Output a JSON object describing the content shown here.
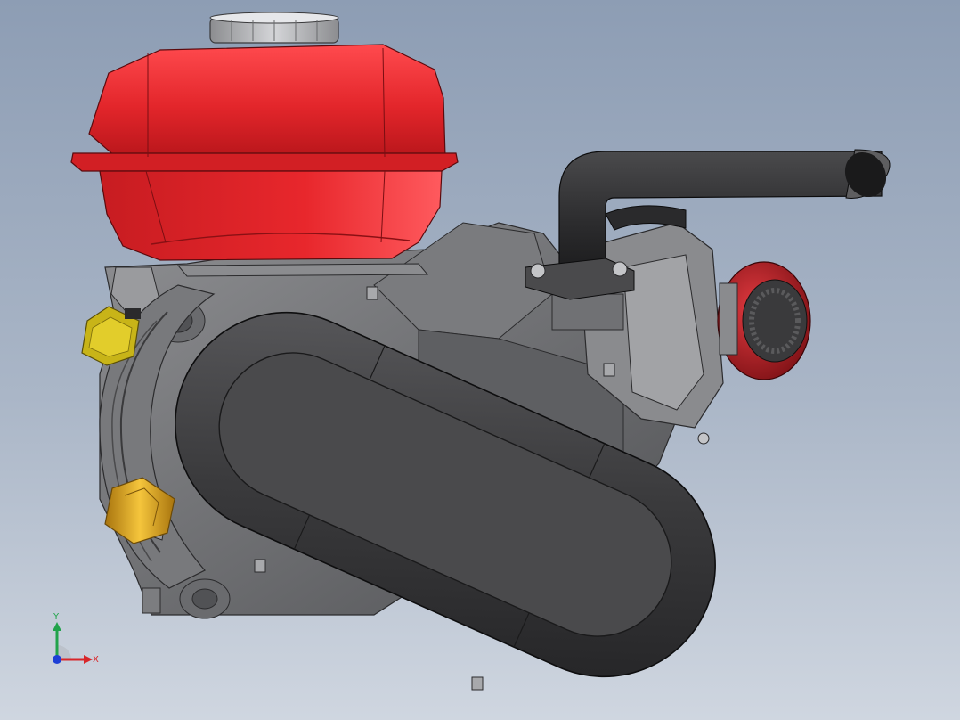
{
  "viewport": {
    "background_top": "#8d9db4",
    "background_bottom": "#cfd6e0"
  },
  "model": {
    "components": [
      "fuel-tank",
      "fuel-cap",
      "exhaust-pipe",
      "belt-guard-cover",
      "air-filter",
      "carburetor",
      "crankcase",
      "pull-starter",
      "brass-fitting",
      "spark-plug-boot"
    ],
    "colors": {
      "fuel_tank": "#e8262a",
      "belt_guard": "#3b3b3d",
      "exhaust": "#2a2a2c",
      "engine_block": "#6e6f72",
      "brass_fitting": "#e0a823",
      "spark_plug_boot": "#c8b418",
      "air_filter_red": "#b31e24"
    }
  },
  "triad": {
    "x_label": "X",
    "y_label": "Y",
    "x_color": "#d8262a",
    "y_color": "#21a34b",
    "z_color": "#1d3fd6"
  }
}
